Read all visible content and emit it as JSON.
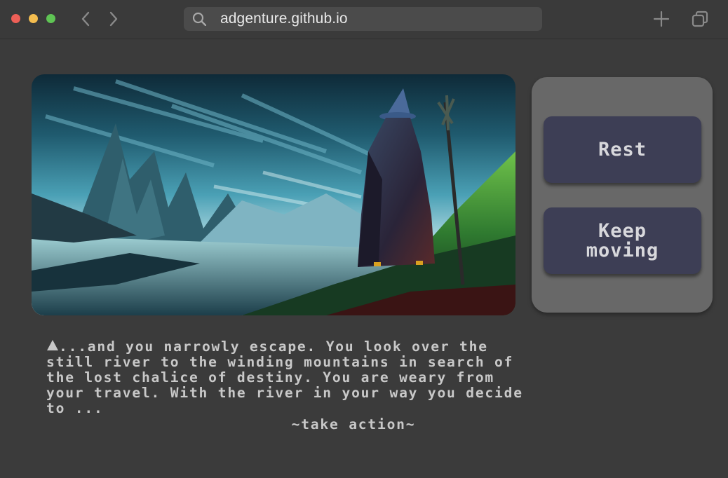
{
  "browser": {
    "url": "adgenture.github.io",
    "controls": {
      "back_icon": "chevron-left-icon",
      "forward_icon": "chevron-right-icon",
      "new_tab_icon": "plus-icon",
      "tabs_icon": "tabs-overview-icon"
    }
  },
  "scene": {
    "image": "pixel-art-wizard-overlooking-river-and-mountains"
  },
  "actions": {
    "rest_label": "Rest",
    "keep_moving_label": "Keep\nmoving"
  },
  "story": {
    "lines": [
      "...and you narrowly escape. You look over the",
      "still river to the winding mountains in search of",
      "the lost chalice of destiny. You are weary from",
      "your travel. With the river in your way you decide",
      "to ..."
    ],
    "prompt": "~take action~"
  },
  "colors": {
    "background": "#3b3b3b",
    "panel": "#686868",
    "button": "#3d3e55",
    "text": "#c8c8c8"
  }
}
